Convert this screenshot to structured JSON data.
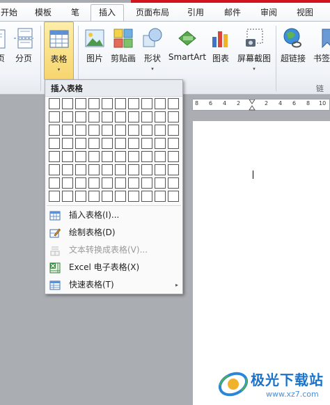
{
  "tabs": [
    {
      "label": "开始",
      "active": false
    },
    {
      "label": "模板",
      "active": false
    },
    {
      "label": "笔",
      "active": false
    },
    {
      "label": "插入",
      "active": true
    },
    {
      "label": "页面布局",
      "active": false
    },
    {
      "label": "引用",
      "active": false
    },
    {
      "label": "邮件",
      "active": false
    },
    {
      "label": "审阅",
      "active": false
    },
    {
      "label": "视图",
      "active": false
    }
  ],
  "ribbon": {
    "page_label": "页",
    "pagebreak_label": "分页",
    "table_label": "表格",
    "picture_label": "图片",
    "clipart_label": "剪贴画",
    "shapes_label": "形状",
    "smartart_label": "SmartArt",
    "chart_label": "图表",
    "screenshot_label": "屏幕截图",
    "hyperlink_label": "超链接",
    "bookmark_label": "书签",
    "links_group_label": "链接",
    "dropdown_arrow": "▾"
  },
  "ruler": {
    "ticks": [
      "8",
      "6",
      "4",
      "2",
      "2",
      "4",
      "6",
      "8",
      "10"
    ]
  },
  "menu": {
    "title": "插入表格",
    "items": [
      {
        "label": "插入表格(I)...",
        "disabled": false,
        "icon": "insert-table-icon"
      },
      {
        "label": "绘制表格(D)",
        "disabled": false,
        "icon": "draw-table-icon"
      },
      {
        "label": "文本转换成表格(V)...",
        "disabled": true,
        "icon": "text-to-table-icon"
      },
      {
        "label": "Excel 电子表格(X)",
        "disabled": false,
        "icon": "excel-icon"
      },
      {
        "label": "快速表格(T)",
        "disabled": false,
        "icon": "quick-table-icon",
        "submenu": "▸"
      }
    ]
  },
  "watermark": {
    "name": "极光下载站",
    "url": "www.xz7.com"
  }
}
